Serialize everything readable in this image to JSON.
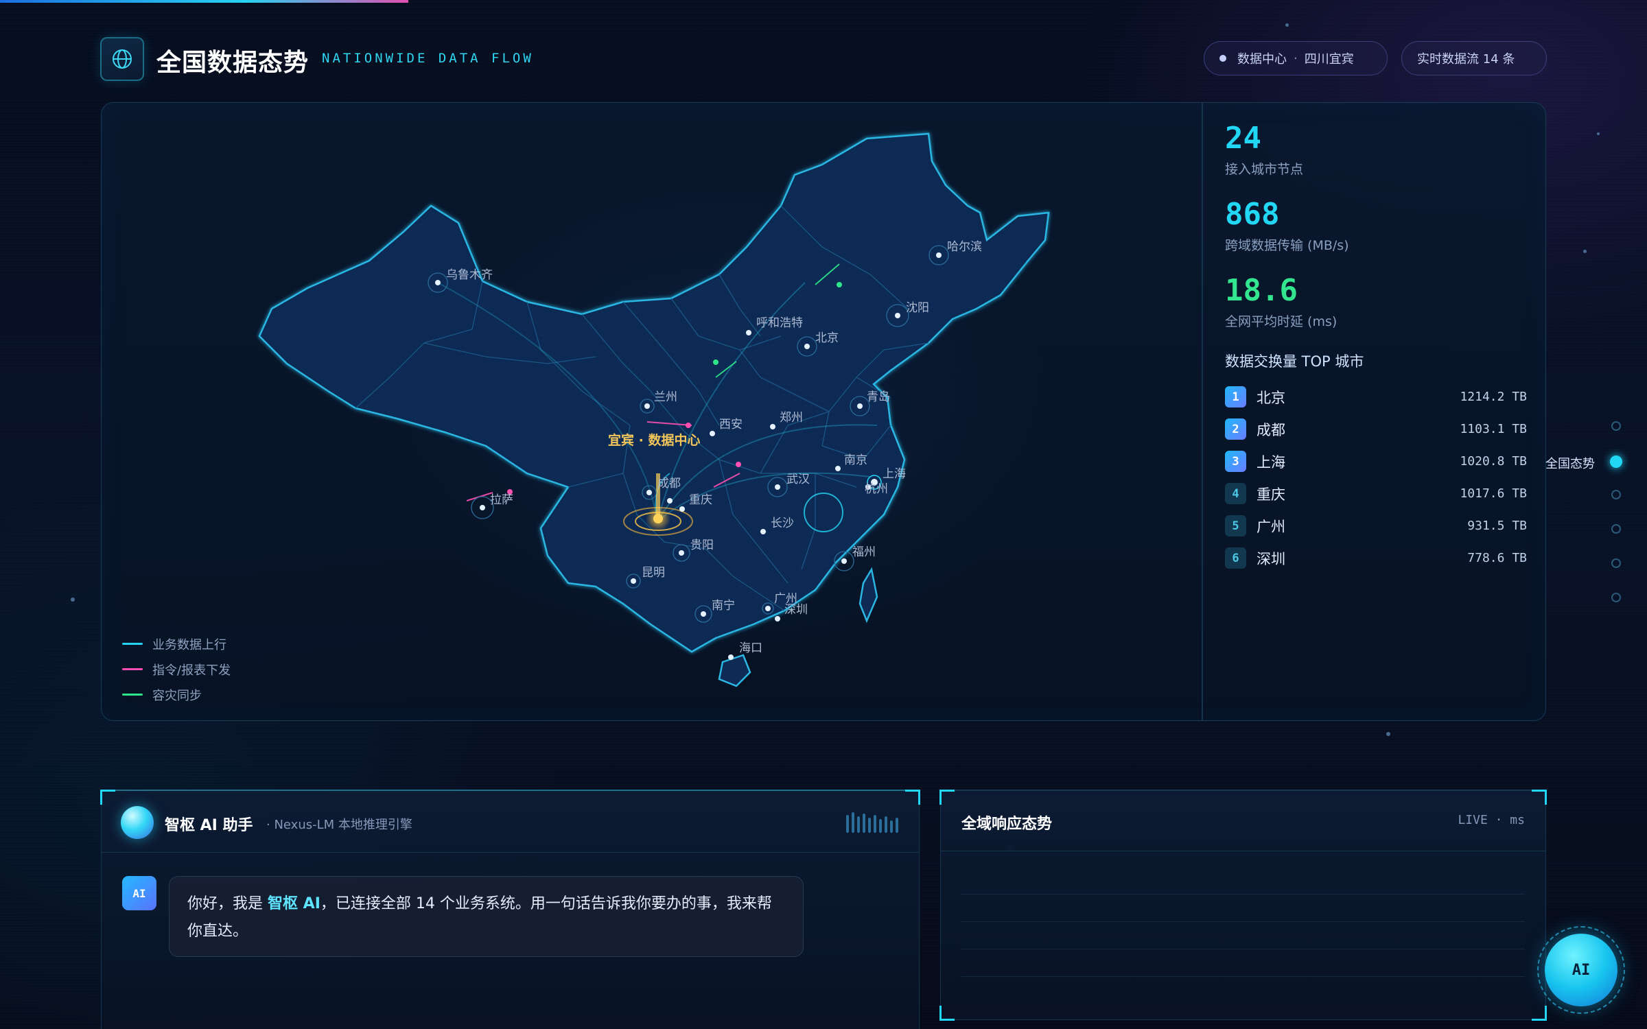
{
  "header": {
    "title": "全国数据态势",
    "subtitle": "NATIONWIDE DATA FLOW",
    "datacenter_pill": {
      "label": "数据中心",
      "location": "四川宜宾"
    },
    "stream_pill": "实时数据流 14 条"
  },
  "map": {
    "datacenter_label": "宜宾 · 数据中心",
    "cities": {
      "urumqi": "乌鲁木齐",
      "harbin": "哈尔滨",
      "shenyang": "沈阳",
      "hohhot": "呼和浩特",
      "beijing": "北京",
      "qingdao": "青岛",
      "lanzhou": "兰州",
      "xian": "西安",
      "zhengzhou": "郑州",
      "nanjing": "南京",
      "shanghai": "上海",
      "hangzhou": "杭州",
      "lhasa": "拉萨",
      "chengdu": "成都",
      "chongqing": "重庆",
      "wuhan": "武汉",
      "changsha": "长沙",
      "guiyang": "贵阳",
      "kunming": "昆明",
      "fuzhou": "福州",
      "nanning": "南宁",
      "guangzhou": "广州",
      "shenzhen": "深圳",
      "haikou": "海口"
    },
    "legend": [
      {
        "label": "业务数据上行",
        "color": "#27d3f2"
      },
      {
        "label": "指令/报表下发",
        "color": "#ff4fb3"
      },
      {
        "label": "容灾同步",
        "color": "#2fe58a"
      }
    ]
  },
  "stats": [
    {
      "value": "24",
      "label": "接入城市节点",
      "color": "#22d7f3"
    },
    {
      "value": "868",
      "label": "跨域数据传输 (MB/s)",
      "color": "#22d7f3"
    },
    {
      "value": "18.6",
      "label": "全网平均时延 (ms)",
      "color": "#34e58f"
    }
  ],
  "top_cities": {
    "title": "数据交换量 TOP 城市",
    "rows": [
      {
        "rank": "1",
        "city": "北京",
        "value": "1214.2 TB"
      },
      {
        "rank": "2",
        "city": "成都",
        "value": "1103.1 TB"
      },
      {
        "rank": "3",
        "city": "上海",
        "value": "1020.8 TB"
      },
      {
        "rank": "4",
        "city": "重庆",
        "value": "1017.6 TB"
      },
      {
        "rank": "5",
        "city": "广州",
        "value": "931.5 TB"
      },
      {
        "rank": "6",
        "city": "深圳",
        "value": "778.6 TB"
      }
    ]
  },
  "side_nav": {
    "active_label": "全国态势"
  },
  "ai": {
    "name": "智枢 AI 助手",
    "engine": "· Nexus-LM 本地推理引擎",
    "avatar": "AI",
    "message_pre": "你好，我是",
    "message_highlight": "智枢 AI",
    "message_post": "，已连接全部 14 个业务系统。用一句话告诉我你要办的事，我来帮你直达。"
  },
  "response": {
    "title": "全域响应态势",
    "live": "LIVE · ms"
  },
  "fab": {
    "label": "AI"
  }
}
